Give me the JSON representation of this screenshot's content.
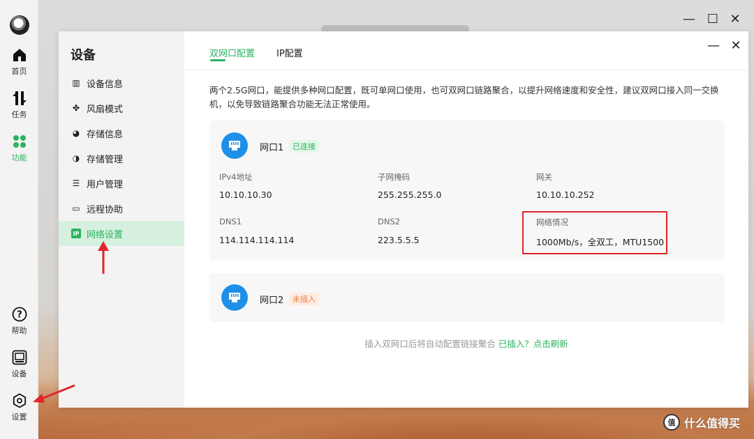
{
  "rail": {
    "items": [
      {
        "label": "首页",
        "icon": "home-icon"
      },
      {
        "label": "任务",
        "icon": "transfer-icon"
      },
      {
        "label": "功能",
        "icon": "apps-grid-icon"
      },
      {
        "label": "帮助",
        "icon": "help-icon"
      },
      {
        "label": "设备",
        "icon": "device-icon"
      },
      {
        "label": "设置",
        "icon": "settings-icon"
      }
    ]
  },
  "outer_window": {
    "minimize": "—",
    "maximize": "☐",
    "close": "✕"
  },
  "sidebar": {
    "title": "设备",
    "items": [
      {
        "label": "设备信息",
        "icon": "device-info-icon"
      },
      {
        "label": "风扇模式",
        "icon": "fan-icon"
      },
      {
        "label": "存储信息",
        "icon": "storage-pie-icon"
      },
      {
        "label": "存储管理",
        "icon": "storage-manage-icon"
      },
      {
        "label": "用户管理",
        "icon": "users-icon"
      },
      {
        "label": "远程协助",
        "icon": "monitor-icon"
      },
      {
        "label": "网络设置",
        "icon": "network-ip-icon",
        "icon_text": "IP",
        "active": true
      }
    ]
  },
  "tabs": [
    {
      "label": "双网口配置",
      "active": true
    },
    {
      "label": "IP配置",
      "active": false
    }
  ],
  "dialog_controls": {
    "minimize": "—",
    "close": "✕"
  },
  "description": "两个2.5G网口，能提供多种网口配置，既可单网口使用，也可双网口链路聚合，以提升网络速度和安全性，建议双网口接入同一交换机，以免导致链路聚合功能无法正常使用。",
  "port1": {
    "name": "网口1",
    "status": "已连接",
    "fields": {
      "ipv4_label": "IPv4地址",
      "ipv4_value": "10.10.10.30",
      "mask_label": "子网掩码",
      "mask_value": "255.255.255.0",
      "gateway_label": "网关",
      "gateway_value": "10.10.10.252",
      "dns1_label": "DNS1",
      "dns1_value": "114.114.114.114",
      "dns2_label": "DNS2",
      "dns2_value": "223.5.5.5",
      "net_label": "网络情况",
      "net_value": "1000Mb/s，全双工，MTU1500"
    }
  },
  "port2": {
    "name": "网口2",
    "status": "未插入"
  },
  "footer": {
    "text": "插入双网口后将自动配置链接聚合",
    "link": "已插入？点击刷新"
  },
  "watermark": {
    "logo": "值",
    "text": "什么值得买"
  },
  "colors": {
    "accent": "#2bb35f",
    "port_icon": "#1e90e8",
    "warning": "#f07a3a",
    "annotation": "#e0262b"
  }
}
